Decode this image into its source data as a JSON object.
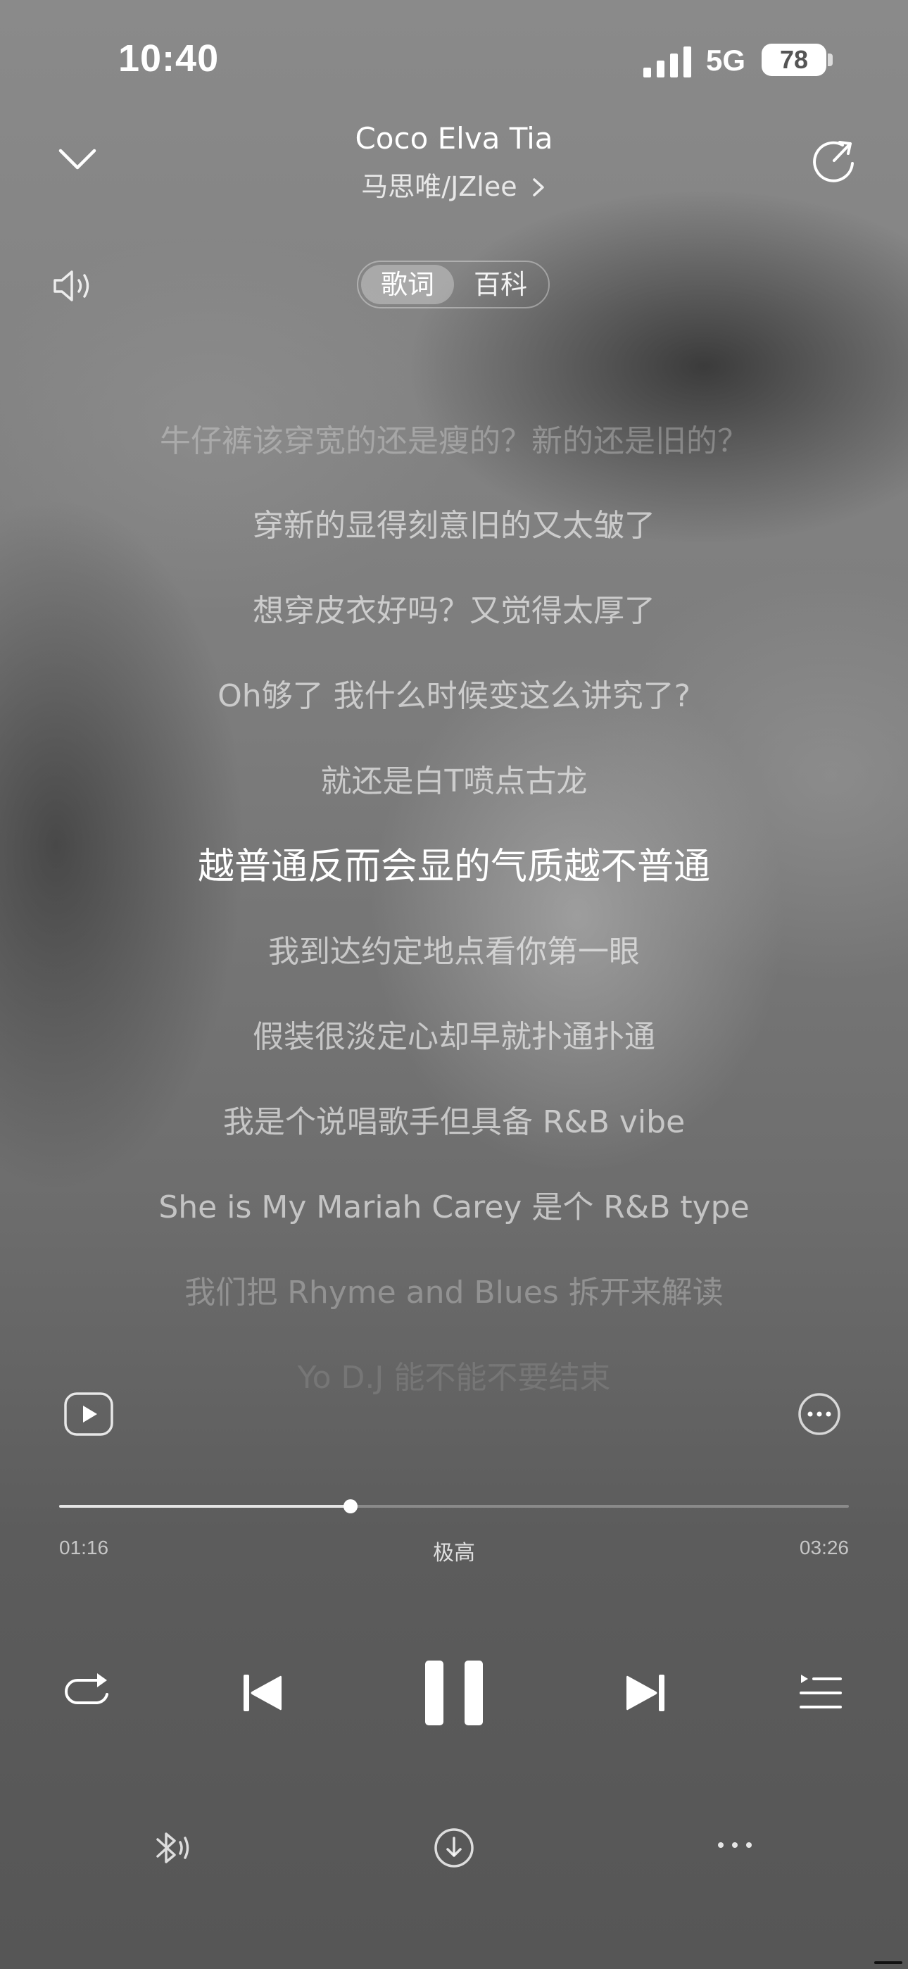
{
  "status_bar": {
    "time": "10:40",
    "network": "5G",
    "battery": "78"
  },
  "header": {
    "title": "Coco Elva Tia",
    "artist": "马思唯/JZlee",
    "tabs": [
      {
        "label": "歌词",
        "active": true
      },
      {
        "label": "百科",
        "active": false
      }
    ]
  },
  "lyrics": {
    "lines": [
      {
        "text": "牛仔裤该穿宽的还是瘦的？新的还是旧的？",
        "state": "faded"
      },
      {
        "text": "穿新的显得刻意旧的又太皱了",
        "state": "normal"
      },
      {
        "text": "想穿皮衣好吗？又觉得太厚了",
        "state": "normal"
      },
      {
        "text": "Oh够了 我什么时候变这么讲究了?",
        "state": "normal"
      },
      {
        "text": "就还是白T喷点古龙",
        "state": "normal"
      },
      {
        "text": "越普通反而会显的气质越不普通",
        "state": "current"
      },
      {
        "text": "我到达约定地点看你第一眼",
        "state": "normal"
      },
      {
        "text": "假装很淡定心却早就扑通扑通",
        "state": "normal"
      },
      {
        "text": "我是个说唱歌手但具备 R&B vibe",
        "state": "normal"
      },
      {
        "text": "She is My Mariah Carey 是个 R&B type",
        "state": "normal"
      },
      {
        "text": "我们把 Rhyme and Blues 拆开来解读",
        "state": "faded"
      },
      {
        "text": "Yo D.J 能不能不要结束",
        "state": "faded2"
      }
    ]
  },
  "player": {
    "elapsed": "01:16",
    "duration": "03:26",
    "progress": 0.369,
    "quality": "极高"
  },
  "icons": {
    "collapse": "chevron-down-icon",
    "share": "share-icon",
    "volume": "speaker-icon",
    "video": "video-play-icon",
    "more_circle": "more-circle-icon",
    "repeat": "repeat-icon",
    "previous": "previous-icon",
    "pause": "pause-icon",
    "next": "next-icon",
    "playlist": "playlist-icon",
    "bluetooth": "bluetooth-audio-icon",
    "download": "download-icon",
    "more": "more-icon"
  }
}
